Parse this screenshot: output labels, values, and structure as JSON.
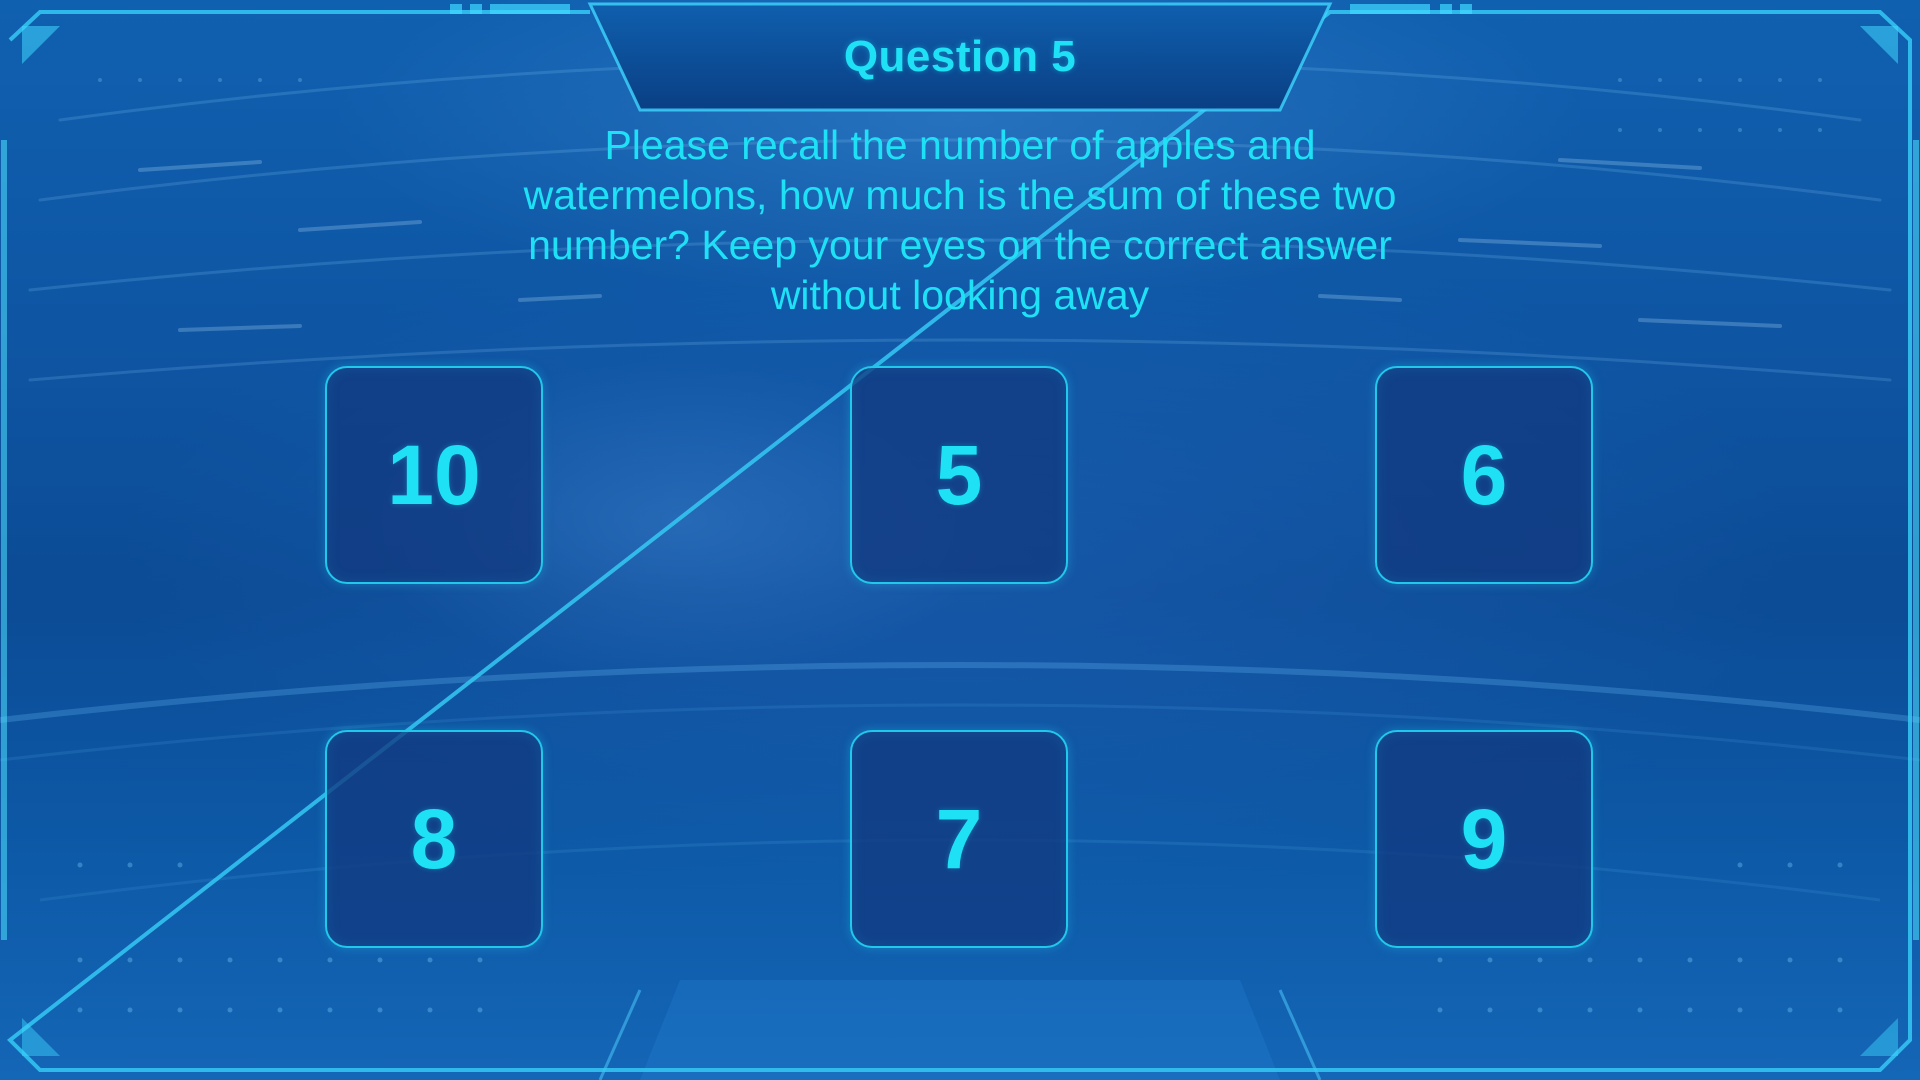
{
  "header": {
    "title": "Question 5"
  },
  "question": {
    "text": "Please recall  the number of apples and\nwatermelons, how much is the sum of these two\nnumber? Keep your eyes on the correct answer\nwithout looking away"
  },
  "answers": [
    {
      "label": "10"
    },
    {
      "label": "5"
    },
    {
      "label": "6"
    },
    {
      "label": "8"
    },
    {
      "label": "7"
    },
    {
      "label": "9"
    }
  ],
  "colors": {
    "accent": "#1ee1f6",
    "border": "#21c8ea",
    "background": "#0c4b95",
    "tile": "#123a80"
  }
}
